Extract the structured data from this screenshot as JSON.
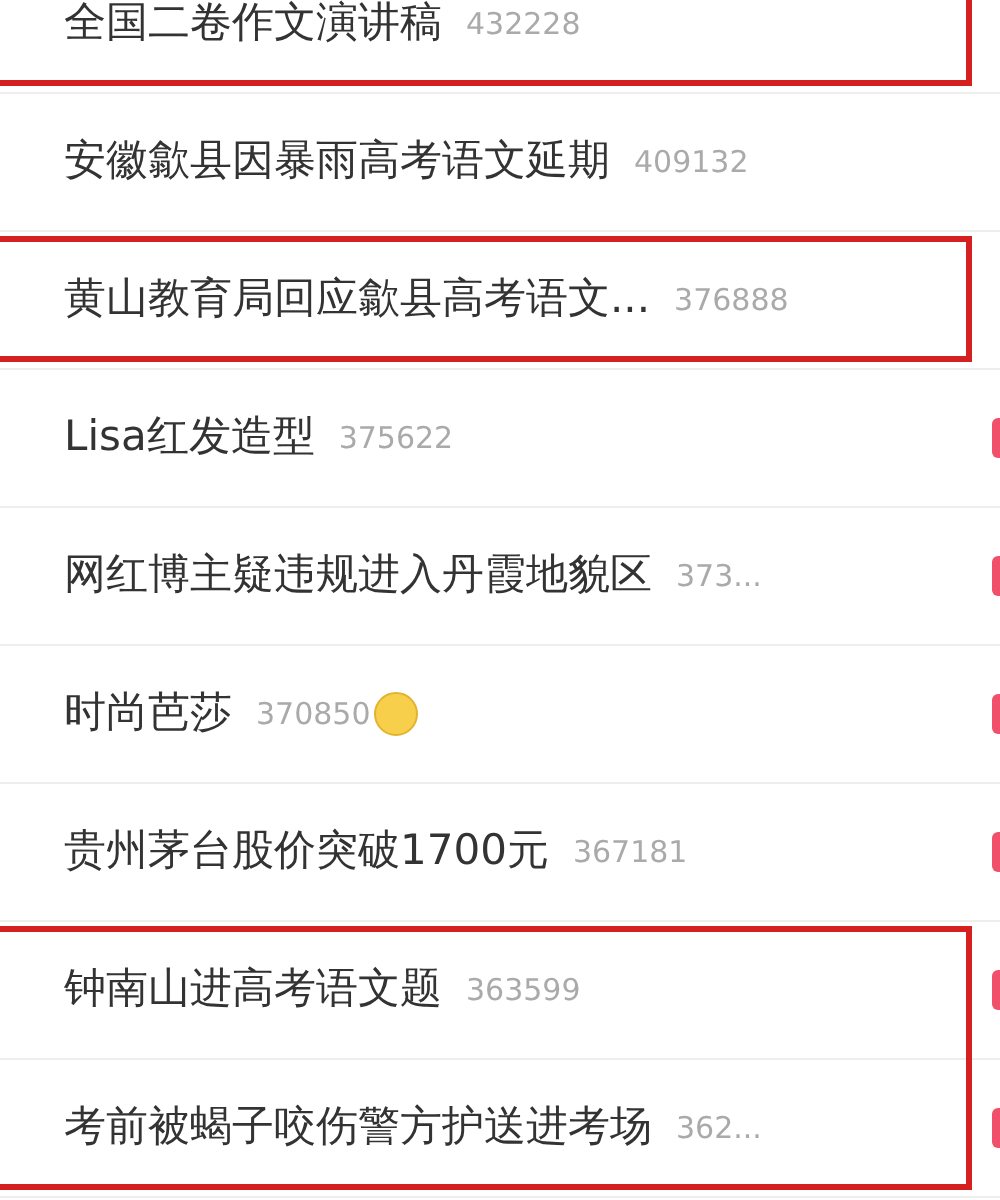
{
  "rows": [
    {
      "title": "全国二卷作文演讲稿",
      "count": "432228",
      "highlighted": true,
      "badge": false,
      "emoji": false
    },
    {
      "title": "安徽歙县因暴雨高考语文延期",
      "count": "409132",
      "highlighted": false,
      "badge": false,
      "emoji": false
    },
    {
      "title": "黄山教育局回应歙县高考语文...",
      "count": "376888",
      "highlighted": true,
      "badge": false,
      "emoji": false
    },
    {
      "title": "Lisa红发造型",
      "count": "375622",
      "highlighted": false,
      "badge": true,
      "emoji": false
    },
    {
      "title": "网红博主疑违规进入丹霞地貌区",
      "count": "373...",
      "highlighted": false,
      "badge": true,
      "emoji": false
    },
    {
      "title": "时尚芭莎",
      "count": "370850",
      "highlighted": false,
      "badge": true,
      "emoji": true
    },
    {
      "title": "贵州茅台股价突破1700元",
      "count": "367181",
      "highlighted": false,
      "badge": true,
      "emoji": false
    },
    {
      "title": "钟南山进高考语文题",
      "count": "363599",
      "highlighted": true,
      "badge": true,
      "emoji": false
    },
    {
      "title": "考前被蝎子咬伤警方护送进考场",
      "count": "362...",
      "highlighted": true,
      "badge": true,
      "emoji": false
    }
  ]
}
